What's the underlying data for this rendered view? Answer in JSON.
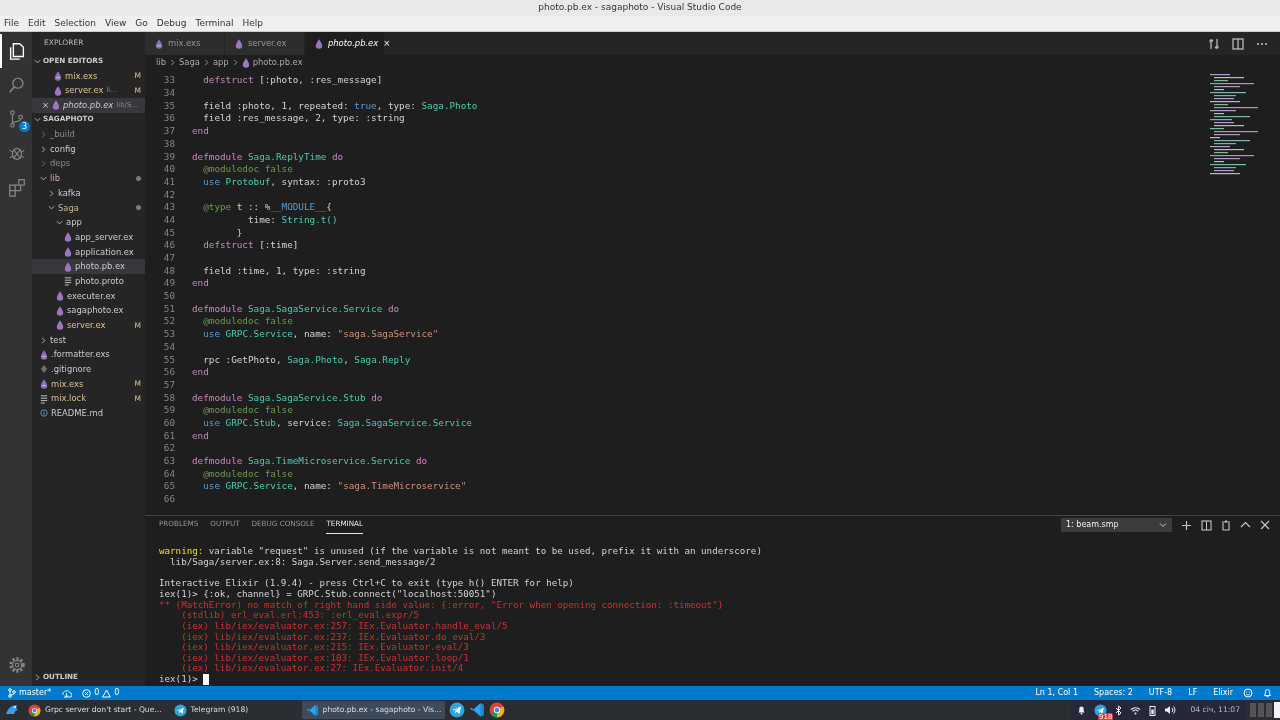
{
  "window": {
    "title": "photo.pb.ex - sagaphoto - Visual Studio Code"
  },
  "menu": [
    "File",
    "Edit",
    "Selection",
    "View",
    "Go",
    "Debug",
    "Terminal",
    "Help"
  ],
  "activity_bar": [
    {
      "kind": "files",
      "selected": true
    },
    {
      "kind": "search",
      "selected": false
    },
    {
      "kind": "scm",
      "selected": false,
      "badge": "3"
    },
    {
      "kind": "debug",
      "selected": false
    },
    {
      "kind": "extensions",
      "selected": false
    },
    {
      "kind": "settings",
      "selected": false
    }
  ],
  "sidebar": {
    "title": "EXPLORER",
    "open_editors": {
      "title": "OPEN EDITORS",
      "expanded": true,
      "items": [
        {
          "name": "mix.exs",
          "kind": "script",
          "badge": "M",
          "selected": false,
          "preview": false
        },
        {
          "name": "server.ex",
          "description": "li...",
          "kind": "elixir",
          "badge": "M",
          "selected": false,
          "preview": false
        },
        {
          "name": "photo.pb.ex",
          "description": "lib/S...",
          "kind": "elixir",
          "close": "×",
          "selected": true,
          "preview": true
        }
      ]
    },
    "project": {
      "title": "SAGAPHOTO",
      "expanded": true,
      "items": [
        {
          "kind": "folder",
          "name": "_build",
          "expanded": false,
          "selected": false,
          "ignored": true
        },
        {
          "kind": "folder",
          "name": "config",
          "expanded": false,
          "selected": false
        },
        {
          "kind": "folder",
          "name": "deps",
          "expanded": false,
          "selected": false,
          "ignored": true
        },
        {
          "kind": "folder",
          "name": "lib",
          "expanded": true,
          "selected": false,
          "dot": true,
          "children": [
            {
              "kind": "folder",
              "name": "kafka",
              "expanded": false,
              "selected": false
            },
            {
              "kind": "folder",
              "name": "Saga",
              "expanded": true,
              "selected": false,
              "dot": true,
              "children": [
                {
                  "kind": "folder",
                  "name": "app",
                  "expanded": true,
                  "selected": false,
                  "children": [
                    {
                      "kind": "elixir",
                      "name": "app_server.ex",
                      "selected": false
                    },
                    {
                      "kind": "elixir",
                      "name": "application.ex",
                      "selected": false
                    },
                    {
                      "kind": "elixir",
                      "name": "photo.pb.ex",
                      "selected": true
                    },
                    {
                      "kind": "text",
                      "name": "photo.proto",
                      "selected": false
                    }
                  ]
                },
                {
                  "kind": "elixir",
                  "name": "executer.ex",
                  "selected": false
                },
                {
                  "kind": "elixir",
                  "name": "sagaphoto.ex",
                  "selected": false
                },
                {
                  "kind": "elixir",
                  "name": "server.ex",
                  "badge": "M",
                  "selected": false
                }
              ]
            }
          ]
        },
        {
          "kind": "folder",
          "name": "test",
          "expanded": false,
          "selected": false
        },
        {
          "kind": "script",
          "name": ".formatter.exs",
          "selected": false
        },
        {
          "kind": "git",
          "name": ".gitignore",
          "selected": false
        },
        {
          "kind": "script",
          "name": "mix.exs",
          "badge": "M",
          "selected": false
        },
        {
          "kind": "text",
          "name": "mix.lock",
          "badge": "M",
          "selected": false
        },
        {
          "kind": "info",
          "name": "README.md",
          "selected": false
        }
      ]
    },
    "outline": {
      "title": "OUTLINE",
      "expanded": false
    }
  },
  "tabs": [
    {
      "name": "mix.exs",
      "kind": "script",
      "selected": false,
      "preview": false
    },
    {
      "name": "server.ex",
      "kind": "elixir",
      "selected": false,
      "preview": false
    },
    {
      "name": "photo.pb.ex",
      "kind": "elixir",
      "selected": true,
      "preview": true,
      "close": "×"
    }
  ],
  "breadcrumb": [
    {
      "text": "lib"
    },
    {
      "text": "Saga"
    },
    {
      "text": "app"
    },
    {
      "text": "photo.pb.ex",
      "kind": "elixir"
    }
  ],
  "code": [
    {
      "n": "33",
      "tokens": [
        {
          "text": "  defstruct",
          "kind": "keyword"
        },
        {
          "text": " [:photo, :res_message]",
          "kind": "plain"
        }
      ]
    },
    {
      "n": "34"
    },
    {
      "n": "35",
      "tokens": [
        {
          "text": "  field :photo, 1, repeated: ",
          "kind": "plain"
        },
        {
          "text": "true",
          "kind": "builtin"
        },
        {
          "text": ", type: ",
          "kind": "plain"
        },
        {
          "text": "Saga.Photo",
          "kind": "module"
        }
      ]
    },
    {
      "n": "36",
      "tokens": [
        {
          "text": "  field :res_message, 2, type: :string",
          "kind": "plain"
        }
      ]
    },
    {
      "n": "37",
      "tokens": [
        {
          "text": "end",
          "kind": "keyword"
        }
      ]
    },
    {
      "n": "38"
    },
    {
      "n": "39",
      "tokens": [
        {
          "text": "defmodule ",
          "kind": "keyword"
        },
        {
          "text": "Saga.ReplyTime",
          "kind": "module"
        },
        {
          "text": " do",
          "kind": "keyword"
        }
      ]
    },
    {
      "n": "40",
      "tokens": [
        {
          "text": "  @moduledoc false",
          "kind": "doc"
        }
      ]
    },
    {
      "n": "41",
      "tokens": [
        {
          "text": "  use ",
          "kind": "builtin"
        },
        {
          "text": "Protobuf",
          "kind": "module"
        },
        {
          "text": ", syntax: :proto3",
          "kind": "plain"
        }
      ]
    },
    {
      "n": "42"
    },
    {
      "n": "43",
      "tokens": [
        {
          "text": "  @type",
          "kind": "doc"
        },
        {
          "text": " t :: %",
          "kind": "plain"
        },
        {
          "text": "__MODULE__",
          "kind": "builtin"
        },
        {
          "text": "{",
          "kind": "plain"
        }
      ]
    },
    {
      "n": "44",
      "tokens": [
        {
          "text": "          time: ",
          "kind": "plain"
        },
        {
          "text": "String.t()",
          "kind": "module"
        }
      ]
    },
    {
      "n": "45",
      "tokens": [
        {
          "text": "        }",
          "kind": "plain"
        }
      ]
    },
    {
      "n": "46",
      "tokens": [
        {
          "text": "  defstruct",
          "kind": "keyword"
        },
        {
          "text": " [:time]",
          "kind": "plain"
        }
      ]
    },
    {
      "n": "47"
    },
    {
      "n": "48",
      "tokens": [
        {
          "text": "  field :time, 1, type: :string",
          "kind": "plain"
        }
      ]
    },
    {
      "n": "49",
      "tokens": [
        {
          "text": "end",
          "kind": "keyword"
        }
      ]
    },
    {
      "n": "50"
    },
    {
      "n": "51",
      "tokens": [
        {
          "text": "defmodule ",
          "kind": "keyword"
        },
        {
          "text": "Saga.SagaService.Service",
          "kind": "module"
        },
        {
          "text": " do",
          "kind": "keyword"
        }
      ]
    },
    {
      "n": "52",
      "tokens": [
        {
          "text": "  @moduledoc false",
          "kind": "doc"
        }
      ]
    },
    {
      "n": "53",
      "tokens": [
        {
          "text": "  use ",
          "kind": "builtin"
        },
        {
          "text": "GRPC.Service",
          "kind": "module"
        },
        {
          "text": ", name: ",
          "kind": "plain"
        },
        {
          "text": "\"saga.SagaService\"",
          "kind": "string"
        }
      ]
    },
    {
      "n": "54"
    },
    {
      "n": "55",
      "tokens": [
        {
          "text": "  rpc :GetPhoto, ",
          "kind": "plain"
        },
        {
          "text": "Saga.Photo",
          "kind": "module"
        },
        {
          "text": ", ",
          "kind": "plain"
        },
        {
          "text": "Saga.Reply",
          "kind": "module"
        }
      ]
    },
    {
      "n": "56",
      "tokens": [
        {
          "text": "end",
          "kind": "keyword"
        }
      ]
    },
    {
      "n": "57"
    },
    {
      "n": "58",
      "tokens": [
        {
          "text": "defmodule ",
          "kind": "keyword"
        },
        {
          "text": "Saga.SagaService.Stub",
          "kind": "module"
        },
        {
          "text": " do",
          "kind": "keyword"
        }
      ]
    },
    {
      "n": "59",
      "tokens": [
        {
          "text": "  @moduledoc false",
          "kind": "doc"
        }
      ]
    },
    {
      "n": "60",
      "tokens": [
        {
          "text": "  use ",
          "kind": "builtin"
        },
        {
          "text": "GRPC.Stub",
          "kind": "module"
        },
        {
          "text": ", service: ",
          "kind": "plain"
        },
        {
          "text": "Saga.SagaService.Service",
          "kind": "module"
        }
      ]
    },
    {
      "n": "61",
      "tokens": [
        {
          "text": "end",
          "kind": "keyword"
        }
      ]
    },
    {
      "n": "62"
    },
    {
      "n": "63",
      "tokens": [
        {
          "text": "defmodule ",
          "kind": "keyword"
        },
        {
          "text": "Saga.TimeMicroservice.Service",
          "kind": "module"
        },
        {
          "text": " do",
          "kind": "keyword"
        }
      ]
    },
    {
      "n": "64",
      "tokens": [
        {
          "text": "  @moduledoc false",
          "kind": "doc"
        }
      ]
    },
    {
      "n": "65",
      "tokens": [
        {
          "text": "  use ",
          "kind": "builtin"
        },
        {
          "text": "GRPC.Service",
          "kind": "module"
        },
        {
          "text": ", name: ",
          "kind": "plain"
        },
        {
          "text": "\"saga.TimeMicroservice\"",
          "kind": "string"
        }
      ]
    },
    {
      "n": "66"
    }
  ],
  "panel": {
    "tabs": [
      {
        "label": "PROBLEMS",
        "selected": false
      },
      {
        "label": "OUTPUT",
        "selected": false
      },
      {
        "label": "DEBUG CONSOLE",
        "selected": false
      },
      {
        "label": "TERMINAL",
        "selected": true
      }
    ],
    "terminal_select": "1: beam.smp",
    "lines": [
      {
        "tokens": [
          {
            "text": "warning:",
            "kind": "warning"
          },
          {
            "text": " variable \"request\" is unused (if the variable is not meant to be used, prefix it with an underscore)",
            "kind": "plain"
          }
        ]
      },
      {
        "tokens": [
          {
            "text": "  lib/Saga/server.ex:8: Saga.Server.send_message/2",
            "kind": "plain"
          }
        ]
      },
      {
        "blank_before": true,
        "tokens": [
          {
            "text": "Interactive Elixir (1.9.4) - press Ctrl+C to exit (type h() ENTER for help)",
            "kind": "plain"
          }
        ]
      },
      {
        "tokens": [
          {
            "text": "iex(1)> {:ok, channel} = GRPC.Stub.connect(\"localhost:50051\")",
            "kind": "plain"
          }
        ]
      },
      {
        "tokens": [
          {
            "text": "** (MatchError) no match of right hand side value: {:error, \"Error when opening connection: :timeout\"}",
            "kind": "error"
          }
        ]
      },
      {
        "tokens": [
          {
            "text": "    (stdlib) erl_eval.erl:453: :erl_eval.expr/5",
            "kind": "error"
          }
        ]
      },
      {
        "tokens": [
          {
            "text": "    (iex) lib/iex/evaluator.ex:257: IEx.Evaluator.handle_eval/5",
            "kind": "error"
          }
        ]
      },
      {
        "tokens": [
          {
            "text": "    (iex) lib/iex/evaluator.ex:237: IEx.Evaluator.do_eval/3",
            "kind": "error"
          }
        ]
      },
      {
        "tokens": [
          {
            "text": "    (iex) lib/iex/evaluator.ex:215: IEx.Evaluator.eval/3",
            "kind": "error"
          }
        ]
      },
      {
        "tokens": [
          {
            "text": "    (iex) lib/iex/evaluator.ex:103: IEx.Evaluator.loop/1",
            "kind": "error"
          }
        ]
      },
      {
        "tokens": [
          {
            "text": "    (iex) lib/iex/evaluator.ex:27: IEx.Evaluator.init/4",
            "kind": "error"
          }
        ]
      },
      {
        "tokens": [
          {
            "text": "iex(1)> ",
            "kind": "plain"
          }
        ],
        "cursor": true
      }
    ]
  },
  "status_bar": {
    "branch": "master*",
    "errors": "0",
    "warnings": "0",
    "right": [
      "Ln 1, Col 1",
      "Spaces: 2",
      "UTF-8",
      "LF",
      "Elixir"
    ]
  },
  "taskbar": {
    "tasks": [
      {
        "label": "Grpc server don't start - Que...",
        "kind": "chrome",
        "selected": false
      },
      {
        "label": "Telegram (918)",
        "kind": "telegram",
        "selected": false
      },
      {
        "label": "photo.pb.ex - sagaphoto - Vis...",
        "kind": "vscode",
        "selected": true
      }
    ],
    "launchers": [
      {
        "kind": "telegram"
      },
      {
        "kind": "vscode"
      },
      {
        "kind": "chrome"
      }
    ],
    "tray_badge": "918",
    "clock": "04 січ, 11:07"
  }
}
